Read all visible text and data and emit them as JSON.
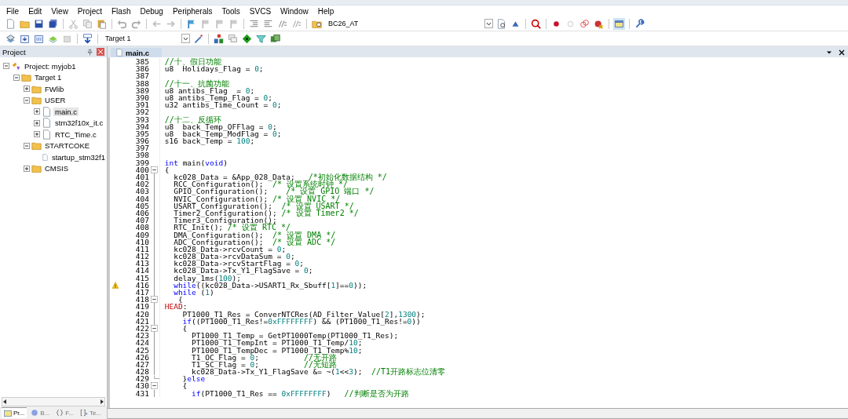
{
  "menu": [
    "File",
    "Edit",
    "View",
    "Project",
    "Flash",
    "Debug",
    "Peripherals",
    "Tools",
    "SVCS",
    "Window",
    "Help"
  ],
  "toolbar": {
    "find_combo": "BC26_AT",
    "target_combo": "Target 1"
  },
  "project_panel": {
    "title": "Project",
    "tree": [
      {
        "kind": "project",
        "label": "Project: myjob1",
        "expanded": true,
        "selected": false,
        "children": [
          {
            "kind": "target",
            "label": "Target 1",
            "expanded": true,
            "selected": false,
            "children": [
              {
                "kind": "folder",
                "label": "FWlib",
                "expanded": false,
                "selected": false
              },
              {
                "kind": "folder",
                "label": "USER",
                "expanded": true,
                "selected": false,
                "children": [
                  {
                    "kind": "file",
                    "label": "main.c",
                    "expanded": false,
                    "selected": true
                  },
                  {
                    "kind": "file",
                    "label": "stm32f10x_it.c",
                    "expanded": false,
                    "selected": false
                  },
                  {
                    "kind": "file",
                    "label": "RTC_Time.c",
                    "expanded": false,
                    "selected": false
                  }
                ]
              },
              {
                "kind": "folder",
                "label": "STARTCOKE",
                "expanded": true,
                "selected": false,
                "children": [
                  {
                    "kind": "leaf",
                    "label": "startup_stm32f1",
                    "selected": false
                  }
                ]
              },
              {
                "kind": "folder",
                "label": "CMSIS",
                "expanded": false,
                "selected": false
              }
            ]
          }
        ]
      }
    ],
    "bottom_tabs": [
      {
        "label": "Pr...",
        "selected": true
      },
      {
        "label": "B...",
        "selected": false
      },
      {
        "label": "F...",
        "selected": false
      },
      {
        "label": "Te...",
        "selected": false
      }
    ]
  },
  "editor": {
    "tabs": [
      {
        "label": "main.c",
        "selected": true
      }
    ],
    "lines": [
      {
        "number": "385",
        "tokens": [
          {
            "kind": "comment",
            "text": "//十、假日功能"
          }
        ]
      },
      {
        "number": "386",
        "tokens": [
          {
            "kind": "plain",
            "text": "u8  Holidays_Flag = "
          },
          {
            "kind": "number",
            "text": "0"
          },
          {
            "kind": "plain",
            "text": ";"
          }
        ]
      },
      {
        "number": "387"
      },
      {
        "number": "388",
        "tokens": [
          {
            "kind": "comment",
            "text": "//十一、抗菌功能"
          }
        ]
      },
      {
        "number": "389",
        "tokens": [
          {
            "kind": "plain",
            "text": "u8 antibs_Flag  = "
          },
          {
            "kind": "number",
            "text": "0"
          },
          {
            "kind": "plain",
            "text": ";"
          }
        ]
      },
      {
        "number": "390",
        "tokens": [
          {
            "kind": "plain",
            "text": "u8 antibs_Temp_Flag = "
          },
          {
            "kind": "number",
            "text": "0"
          },
          {
            "kind": "plain",
            "text": ";"
          }
        ]
      },
      {
        "number": "391",
        "tokens": [
          {
            "kind": "plain",
            "text": "u32 antibs_Time_Count = "
          },
          {
            "kind": "number",
            "text": "0"
          },
          {
            "kind": "plain",
            "text": ";"
          }
        ]
      },
      {
        "number": "392"
      },
      {
        "number": "393",
        "tokens": [
          {
            "kind": "comment",
            "text": "//十二、反循环"
          }
        ]
      },
      {
        "number": "394",
        "tokens": [
          {
            "kind": "plain",
            "text": "u8  back_Temp_OFFlag = "
          },
          {
            "kind": "number",
            "text": "0"
          },
          {
            "kind": "plain",
            "text": ";"
          }
        ]
      },
      {
        "number": "395",
        "tokens": [
          {
            "kind": "plain",
            "text": "u8  back_Temp_ModFlag = "
          },
          {
            "kind": "number",
            "text": "0"
          },
          {
            "kind": "plain",
            "text": ";"
          }
        ]
      },
      {
        "number": "396",
        "tokens": [
          {
            "kind": "plain",
            "text": "s16 back_Temp = "
          },
          {
            "kind": "number",
            "text": "100"
          },
          {
            "kind": "plain",
            "text": ";"
          }
        ]
      },
      {
        "number": "397"
      },
      {
        "number": "398"
      },
      {
        "number": "399",
        "tokens": [
          {
            "kind": "keyword",
            "text": "int"
          },
          {
            "kind": "plain",
            "text": " main("
          },
          {
            "kind": "keyword",
            "text": "void"
          },
          {
            "kind": "plain",
            "text": ")"
          }
        ]
      },
      {
        "number": "400",
        "fold_open": true,
        "tokens": [
          {
            "kind": "plain",
            "text": "{"
          }
        ]
      },
      {
        "number": "401",
        "tokens": [
          {
            "kind": "plain",
            "text": "  kc028_Data = &App_028_Data;   "
          },
          {
            "kind": "comment",
            "text": "/*初始化数据结构 */"
          }
        ]
      },
      {
        "number": "402",
        "tokens": [
          {
            "kind": "plain",
            "text": "  RCC_Configuration();  "
          },
          {
            "kind": "comment",
            "text": "/* 设置系统时钟 */"
          }
        ]
      },
      {
        "number": "403",
        "tokens": [
          {
            "kind": "plain",
            "text": "  GPIO_Configuration();    "
          },
          {
            "kind": "comment",
            "text": "/* 设置 GPIO 端口 */"
          }
        ]
      },
      {
        "number": "404",
        "tokens": [
          {
            "kind": "plain",
            "text": "  NVIC_Configuration(); "
          },
          {
            "kind": "comment",
            "text": "/* 设置 NVIC */"
          }
        ]
      },
      {
        "number": "405",
        "tokens": [
          {
            "kind": "plain",
            "text": "  USART_Configuration();  "
          },
          {
            "kind": "comment",
            "text": "/* 设置 USART */"
          }
        ]
      },
      {
        "number": "406",
        "tokens": [
          {
            "kind": "plain",
            "text": "  Timer2_Configuration(); "
          },
          {
            "kind": "comment",
            "text": "/* 设置 Timer2 */"
          }
        ]
      },
      {
        "number": "407",
        "tokens": [
          {
            "kind": "plain",
            "text": "  Timer3_Configuration();"
          }
        ]
      },
      {
        "number": "408",
        "tokens": [
          {
            "kind": "plain",
            "text": "  RTC_Init(); "
          },
          {
            "kind": "comment",
            "text": "/* 设置 RTC */"
          }
        ]
      },
      {
        "number": "409",
        "tokens": [
          {
            "kind": "plain",
            "text": "  DMA_Configuration();  "
          },
          {
            "kind": "comment",
            "text": "/* 设置 DMA */"
          }
        ]
      },
      {
        "number": "410",
        "tokens": [
          {
            "kind": "plain",
            "text": "  ADC_Configuration();  "
          },
          {
            "kind": "comment",
            "text": "/* 设置 ADC */"
          }
        ]
      },
      {
        "number": "411",
        "tokens": [
          {
            "kind": "plain",
            "text": "  kc028_Data->rcvCount = "
          },
          {
            "kind": "number",
            "text": "0"
          },
          {
            "kind": "plain",
            "text": ";"
          }
        ]
      },
      {
        "number": "412",
        "tokens": [
          {
            "kind": "plain",
            "text": "  kc028_Data->rcvDataSum = "
          },
          {
            "kind": "number",
            "text": "0"
          },
          {
            "kind": "plain",
            "text": ";"
          }
        ]
      },
      {
        "number": "413",
        "tokens": [
          {
            "kind": "plain",
            "text": "  kc028_Data->rcvStartFlag = "
          },
          {
            "kind": "number",
            "text": "0"
          },
          {
            "kind": "plain",
            "text": ";"
          }
        ]
      },
      {
        "number": "414",
        "tokens": [
          {
            "kind": "plain",
            "text": "  kc028_Data->Tx_Y1_FlagSave = "
          },
          {
            "kind": "number",
            "text": "0"
          },
          {
            "kind": "plain",
            "text": ";"
          }
        ]
      },
      {
        "number": "415",
        "tokens": [
          {
            "kind": "plain",
            "text": "  delay_1ms("
          },
          {
            "kind": "number",
            "text": "100"
          },
          {
            "kind": "plain",
            "text": ");"
          }
        ]
      },
      {
        "number": "416",
        "warning": true,
        "tokens": [
          {
            "kind": "keyword",
            "text": "  while"
          },
          {
            "kind": "plain",
            "text": "((kc028_Data->USART1_Rx_Sbuff["
          },
          {
            "kind": "number",
            "text": "1"
          },
          {
            "kind": "plain",
            "text": "]=="
          },
          {
            "kind": "number",
            "text": "0"
          },
          {
            "kind": "plain",
            "text": "));"
          }
        ]
      },
      {
        "number": "417",
        "tokens": [
          {
            "kind": "keyword",
            "text": "  while"
          },
          {
            "kind": "plain",
            "text": " ("
          },
          {
            "kind": "number",
            "text": "1"
          },
          {
            "kind": "plain",
            "text": ")"
          }
        ]
      },
      {
        "number": "418",
        "fold_open": true,
        "tokens": [
          {
            "kind": "plain",
            "text": "   {"
          }
        ]
      },
      {
        "number": "419",
        "tokens": [
          {
            "kind": "label",
            "text": "HEAD"
          },
          {
            "kind": "plain",
            "text": ":"
          }
        ]
      },
      {
        "number": "420",
        "tokens": [
          {
            "kind": "plain",
            "text": "    PT1000_T1_Res = ConverNTCRes(AD_Filter_Value["
          },
          {
            "kind": "number",
            "text": "2"
          },
          {
            "kind": "plain",
            "text": "],"
          },
          {
            "kind": "number",
            "text": "1300"
          },
          {
            "kind": "plain",
            "text": ");"
          }
        ]
      },
      {
        "number": "421",
        "tokens": [
          {
            "kind": "keyword",
            "text": "    if"
          },
          {
            "kind": "plain",
            "text": "((PT1000_T1_Res!="
          },
          {
            "kind": "number",
            "text": "0xFFFFFFFF"
          },
          {
            "kind": "plain",
            "text": ") && (PT1000_T1_Res!="
          },
          {
            "kind": "number",
            "text": "0"
          },
          {
            "kind": "plain",
            "text": "))"
          }
        ]
      },
      {
        "number": "422",
        "fold_open": true,
        "tokens": [
          {
            "kind": "plain",
            "text": "    {"
          }
        ]
      },
      {
        "number": "423",
        "tokens": [
          {
            "kind": "plain",
            "text": "      PT1000_T1_Temp = GetPT1000Temp(PT1000_T1_Res);"
          }
        ]
      },
      {
        "number": "424",
        "tokens": [
          {
            "kind": "plain",
            "text": "      PT1000_T1_TempInt = PT1000_T1_Temp/"
          },
          {
            "kind": "number",
            "text": "10"
          },
          {
            "kind": "plain",
            "text": ";"
          }
        ]
      },
      {
        "number": "425",
        "tokens": [
          {
            "kind": "plain",
            "text": "      PT1000_T1_TempDec = PT1000_T1_Temp%"
          },
          {
            "kind": "number",
            "text": "10"
          },
          {
            "kind": "plain",
            "text": ";"
          }
        ]
      },
      {
        "number": "426",
        "tokens": [
          {
            "kind": "plain",
            "text": "      T1_OC_Flag = "
          },
          {
            "kind": "number",
            "text": "0"
          },
          {
            "kind": "plain",
            "text": ";          "
          },
          {
            "kind": "comment",
            "text": "//无开路"
          }
        ]
      },
      {
        "number": "427",
        "tokens": [
          {
            "kind": "plain",
            "text": "      T1_SC_Flag = "
          },
          {
            "kind": "number",
            "text": "0"
          },
          {
            "kind": "plain",
            "text": ";          "
          },
          {
            "kind": "comment",
            "text": "//无短路"
          }
        ]
      },
      {
        "number": "428",
        "tokens": [
          {
            "kind": "plain",
            "text": "      kc028_Data->Tx_Y1_FlagSave &= ~("
          },
          {
            "kind": "number",
            "text": "1"
          },
          {
            "kind": "plain",
            "text": "<<"
          },
          {
            "kind": "number",
            "text": "3"
          },
          {
            "kind": "plain",
            "text": ");  "
          },
          {
            "kind": "comment",
            "text": "//T1开路标志位清零"
          }
        ]
      },
      {
        "number": "429",
        "fold_end": true,
        "tokens": [
          {
            "kind": "plain",
            "text": "    }"
          },
          {
            "kind": "keyword",
            "text": "else"
          }
        ]
      },
      {
        "number": "430",
        "fold_open": true,
        "tokens": [
          {
            "kind": "plain",
            "text": "    {"
          }
        ]
      },
      {
        "number": "431",
        "tokens": [
          {
            "kind": "keyword",
            "text": "      if"
          },
          {
            "kind": "plain",
            "text": "(PT1000_T1_Res == "
          },
          {
            "kind": "number",
            "text": "0xFFFFFFFF"
          },
          {
            "kind": "plain",
            "text": ")   "
          },
          {
            "kind": "comment",
            "text": "//判断是否为开路"
          }
        ]
      }
    ]
  }
}
